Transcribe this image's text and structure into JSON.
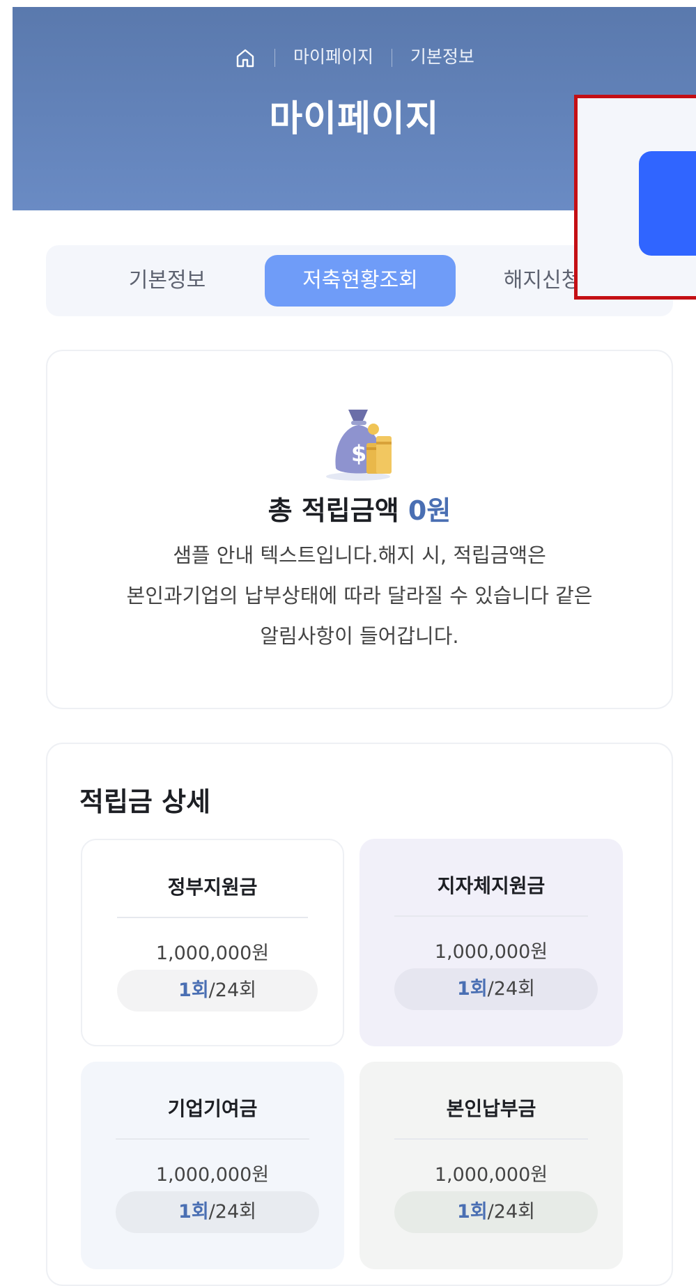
{
  "header": {
    "breadcrumb": [
      "마이페이지",
      "기본정보"
    ],
    "title": "마이페이지",
    "background_color": "#6381b8"
  },
  "tabs": [
    {
      "label": "기본정보",
      "active": false
    },
    {
      "label": "저축현황조회",
      "active": true
    },
    {
      "label": "해지신청",
      "active": false
    }
  ],
  "summary": {
    "total_label": "총 적립금액",
    "total_amount": "0원",
    "notice_lines": [
      "샘플 안내 텍스트입니다.해지 시, 적립금액은",
      "본인과기업의 납부상태에 따라 달라질 수 있습니다 같은",
      "알림사항이 들어갑니다."
    ]
  },
  "detail": {
    "title": "적립금 상세",
    "items": [
      {
        "name": "정부지원금",
        "amount": "1,000,000원",
        "current": "1회",
        "total": "/24회",
        "background": "#ffffff",
        "pill_color": "#f3f3f4"
      },
      {
        "name": "지자체지원금",
        "amount": "1,000,000원",
        "current": "1회",
        "total": "/24회",
        "background": "#f1f0f9",
        "pill_color": "#e6e6f0"
      },
      {
        "name": "기업기여금",
        "amount": "1,000,000원",
        "current": "1회",
        "total": "/24회",
        "background": "#f3f6fb",
        "pill_color": "#e8ebf0"
      },
      {
        "name": "본인납부금",
        "amount": "1,000,000원",
        "current": "1회",
        "total": "/24회",
        "background": "#f3f4f3",
        "pill_color": "#e7ebe7"
      }
    ]
  },
  "colors": {
    "accent": "#6f9cf8",
    "amount_text": "#4a6fb3",
    "highlight_border": "#c40f14",
    "highlight_button": "#3065ff"
  }
}
